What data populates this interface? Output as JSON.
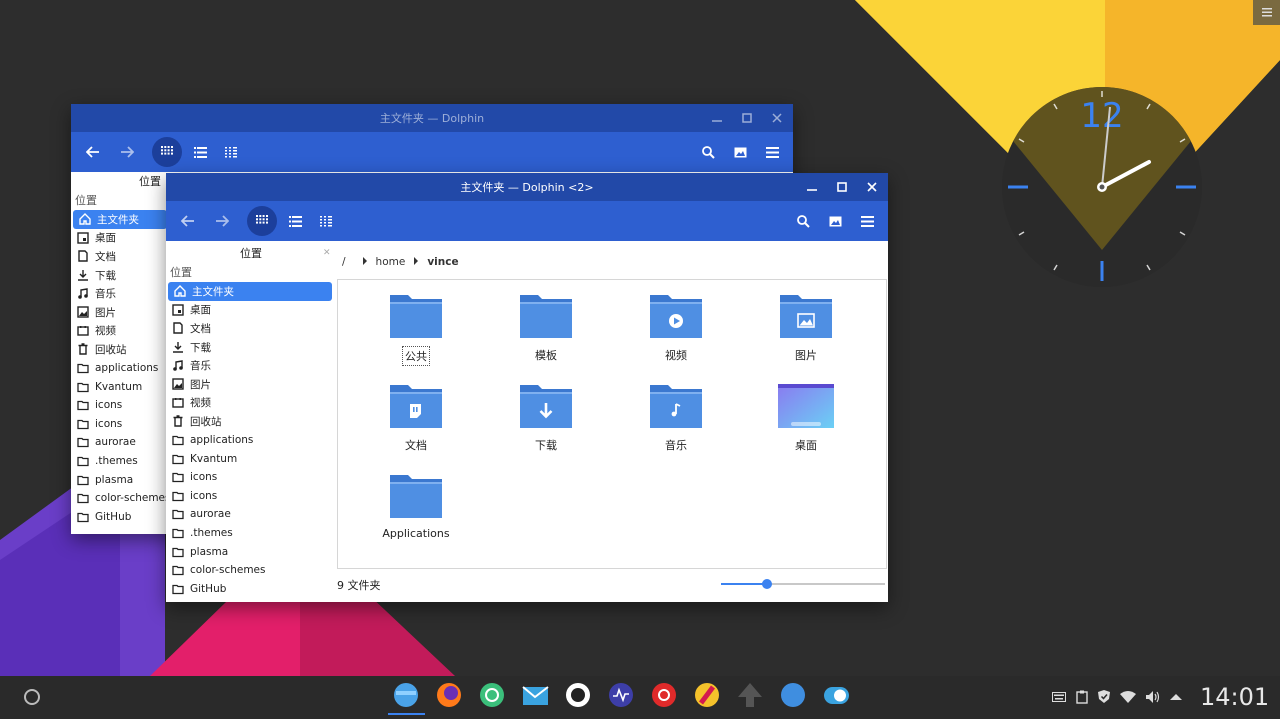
{
  "window_back": {
    "title": "主文件夹 — Dolphin",
    "sidebar_title": "位置",
    "section": "位置",
    "items": [
      "主文件夹",
      "桌面",
      "文档",
      "下载",
      "音乐",
      "图片",
      "视频",
      "回收站",
      "applications",
      "Kvantum",
      "icons",
      "icons",
      "aurorae",
      ".themes",
      "plasma",
      "color-schemes",
      "GitHub"
    ]
  },
  "window_front": {
    "title": "主文件夹 — Dolphin <2>",
    "sidebar_title": "位置",
    "section": "位置",
    "items": [
      "主文件夹",
      "桌面",
      "文档",
      "下载",
      "音乐",
      "图片",
      "视频",
      "回收站",
      "applications",
      "Kvantum",
      "icons",
      "icons",
      "aurorae",
      ".themes",
      "plasma",
      "color-schemes",
      "GitHub"
    ],
    "breadcrumb": {
      "root": "/",
      "home": "home",
      "current": "vince"
    },
    "files": [
      "公共",
      "模板",
      "视频",
      "图片",
      "文档",
      "下载",
      "音乐",
      "桌面",
      "Applications"
    ],
    "status": "9 文件夹",
    "zoom_level": 0.28
  },
  "clock": {
    "numeral": "12",
    "time": "14:01"
  },
  "taskbar": {
    "time": "14:01"
  },
  "colors": {
    "titlebar": "#2249a8",
    "toolbar": "#2e5fd0",
    "accent": "#3b82f0",
    "folder": "#4f8fe3"
  }
}
